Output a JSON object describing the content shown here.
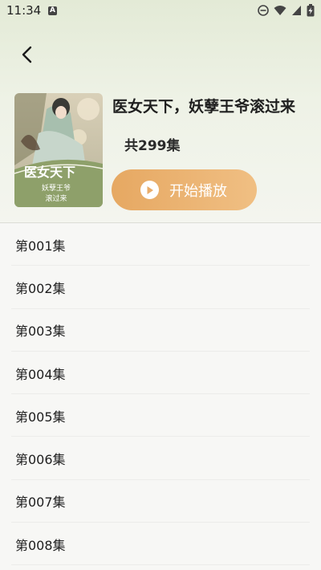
{
  "status_bar": {
    "time": "11:34",
    "notification_letter": "A",
    "icons": [
      "dnd-icon",
      "wifi-icon",
      "signal-icon",
      "battery-charging-icon"
    ]
  },
  "header": {
    "back_icon": "chevron-left-icon"
  },
  "drama": {
    "title": "医女天下，妖孽王爷滚过来",
    "episode_count": "共299集",
    "play_label": "开始播放",
    "play_icon": "play-circle-icon",
    "accent_color": "#e9ad6b"
  },
  "episodes": [
    {
      "label": "第001集"
    },
    {
      "label": "第002集"
    },
    {
      "label": "第003集"
    },
    {
      "label": "第004集"
    },
    {
      "label": "第005集"
    },
    {
      "label": "第006集"
    },
    {
      "label": "第007集"
    },
    {
      "label": "第008集"
    }
  ]
}
